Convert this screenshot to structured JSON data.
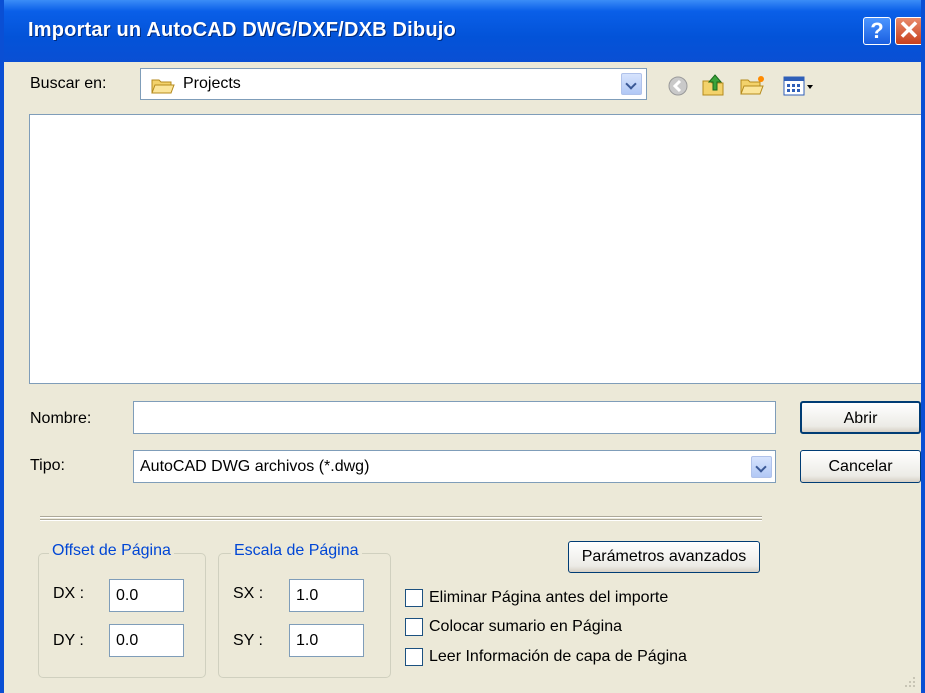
{
  "window": {
    "title": "Importar un AutoCAD DWG/DXF/DXB Dibujo",
    "help_label": "?",
    "close_label": "✕"
  },
  "lookin": {
    "label": "Buscar en:",
    "value": "Projects"
  },
  "filename": {
    "label": "Nombre:",
    "value": ""
  },
  "filetype": {
    "label": "Tipo:",
    "value": "AutoCAD DWG archivos (*.dwg)"
  },
  "buttons": {
    "open": "Abrir",
    "cancel": "Cancelar",
    "advanced": "Parámetros avanzados"
  },
  "offset_group": {
    "title": "Offset de Página",
    "dx_label": "DX :",
    "dx_value": "0.0",
    "dy_label": "DY :",
    "dy_value": "0.0"
  },
  "scale_group": {
    "title": "Escala de Página",
    "sx_label": "SX :",
    "sx_value": "1.0",
    "sy_label": "SY :",
    "sy_value": "1.0"
  },
  "options": [
    {
      "label": "Eliminar Página antes del importe",
      "checked": false
    },
    {
      "label": "Colocar sumario en Página",
      "checked": false
    },
    {
      "label": "Leer Información de capa de Página",
      "checked": false
    }
  ],
  "colors": {
    "titlebar": "#0a4fd4",
    "dialog_bg": "#ece9d8",
    "group_label": "#0046d5",
    "input_border": "#7f9db9"
  }
}
